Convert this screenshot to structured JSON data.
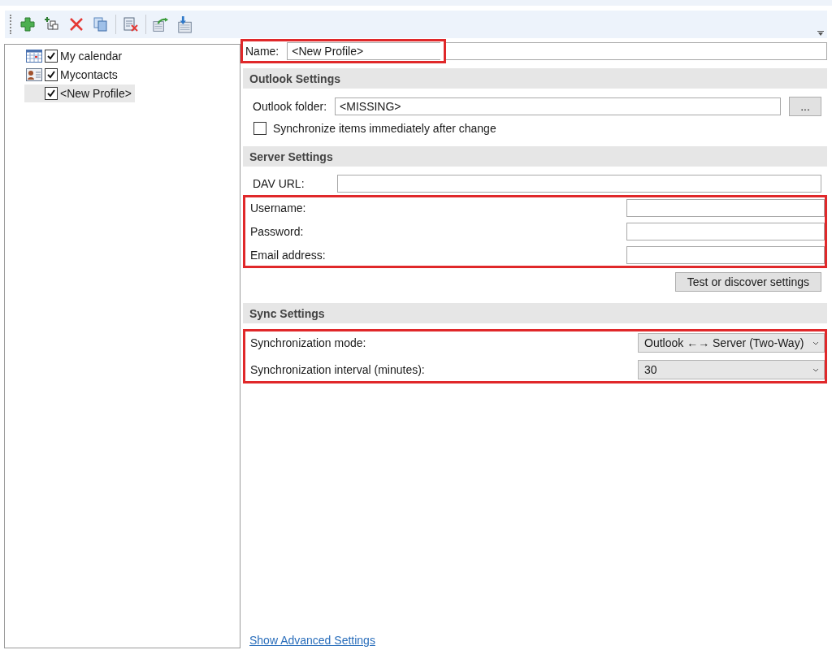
{
  "toolbar": {
    "buttons": [
      {
        "kind": "add"
      },
      {
        "kind": "add-multiple"
      },
      {
        "kind": "delete"
      },
      {
        "kind": "copy"
      },
      {
        "kind": "clear"
      },
      {
        "kind": "export"
      },
      {
        "kind": "import"
      }
    ]
  },
  "tree": {
    "items": [
      {
        "label": "My calendar",
        "kind": "calendar",
        "checked": true,
        "selected": false
      },
      {
        "label": "Mycontacts",
        "kind": "contacts",
        "checked": true,
        "selected": false
      },
      {
        "label": "<New Profile>",
        "kind": "profile",
        "checked": true,
        "selected": true
      }
    ]
  },
  "name_field": {
    "label": "Name:",
    "value": "<New Profile>",
    "highlighted": true
  },
  "outlook_settings": {
    "title": "Outlook Settings",
    "folder_label": "Outlook folder:",
    "folder_value": "<MISSING>",
    "browse_button": "...",
    "sync_immediately": {
      "label": "Synchronize items immediately after change",
      "checked": false
    }
  },
  "server_settings": {
    "title": "Server Settings",
    "dav_url_label": "DAV URL:",
    "credentials": {
      "highlighted": true,
      "fields": [
        {
          "label": "Username:"
        },
        {
          "label": "Password:"
        },
        {
          "label": "Email address:"
        }
      ]
    },
    "test_button": "Test or discover settings"
  },
  "sync_settings": {
    "title": "Sync Settings",
    "highlighted": true,
    "fields": [
      {
        "label": "Synchronization mode:",
        "value": "Outlook ←→ Server (Two-Way)"
      },
      {
        "label": "Synchronization interval (minutes):",
        "value": "30"
      }
    ]
  },
  "advanced_link": "Show Advanced Settings"
}
